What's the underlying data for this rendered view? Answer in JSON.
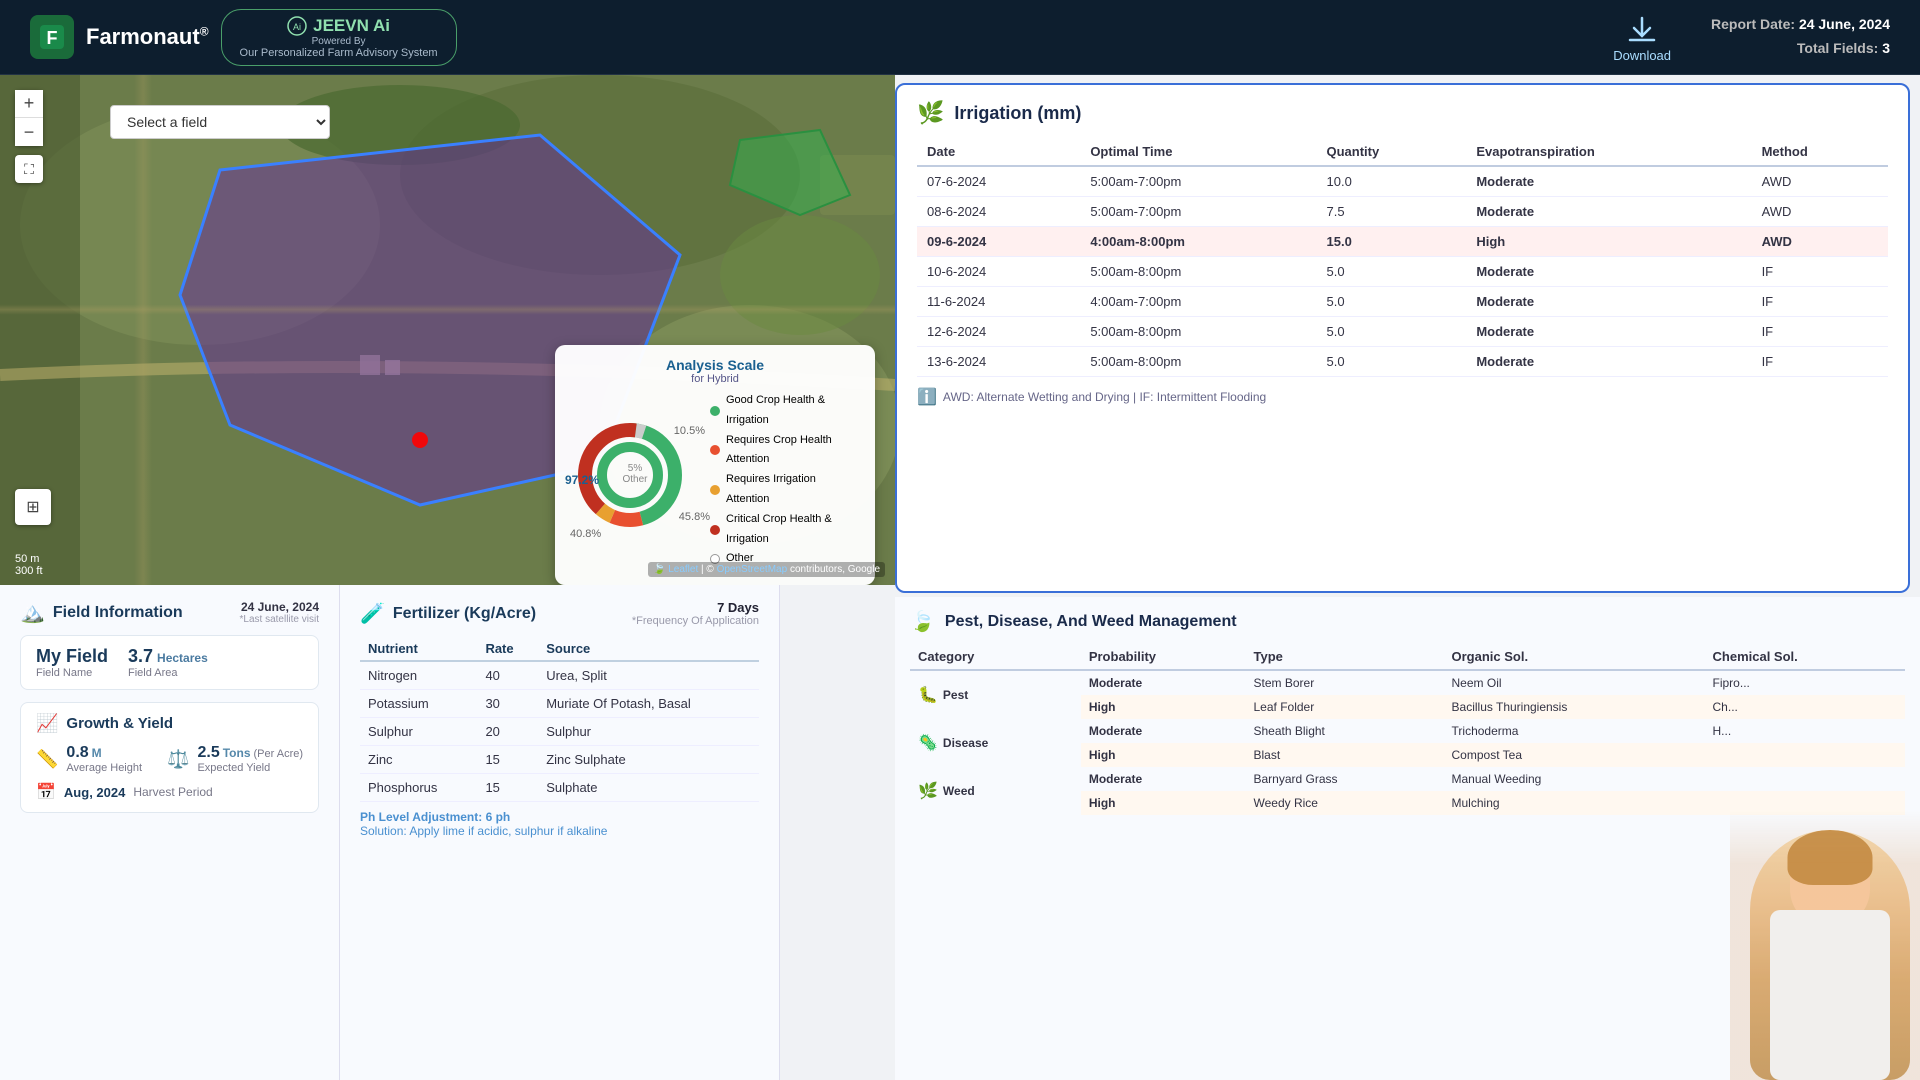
{
  "header": {
    "logo_letter": "F",
    "app_name": "Farmonaut",
    "reg_symbol": "®",
    "jeevn_title": "JEEVN Ai",
    "powered_by": "Powered By",
    "jeevn_sub": "Our Personalized Farm Advisory System",
    "download_label": "Download",
    "report_date_label": "Report Date:",
    "report_date": "24 June, 2024",
    "total_fields_label": "Total Fields:",
    "total_fields": "3"
  },
  "map": {
    "field_select_placeholder": "Select a field",
    "zoom_in": "+",
    "zoom_out": "−",
    "scale_m": "50 m",
    "scale_ft": "300 ft",
    "attribution": "Leaflet | © OpenStreetMap contributors, Google"
  },
  "analysis_scale": {
    "title": "Analysis Scale",
    "subtitle": "for Hybrid",
    "percent_97": "97.2%",
    "percent_105": "10.5%",
    "percent_458": "45.8%",
    "percent_5": "5%",
    "percent_other_label": "Other",
    "percent_408": "40.8%",
    "legend": [
      {
        "color": "#3cb06a",
        "label": "Good Crop Health & Irrigation"
      },
      {
        "color": "#e85030",
        "label": "Requires Crop Health Attention"
      },
      {
        "color": "#e8a030",
        "label": "Requires Irrigation Attention"
      },
      {
        "color": "#c03020",
        "label": "Critical Crop Health & Irrigation"
      },
      {
        "color": "#ffffff",
        "label": "Other",
        "border": "#999"
      }
    ]
  },
  "field_info": {
    "title": "Field Information",
    "date": "24 June, 2024",
    "last_sat": "*Last satellite visit",
    "field_name": "My Field",
    "field_name_label": "Field Name",
    "area_value": "3.7",
    "area_unit": "Hectares",
    "area_label": "Field Area",
    "growth_title": "Growth & Yield",
    "height_value": "0.8",
    "height_unit": "M",
    "height_label": "Average Height",
    "yield_value": "2.5",
    "yield_unit": "Tons",
    "yield_per": "(Per Acre)",
    "yield_label": "Expected Yield",
    "harvest_month": "Aug, 2024",
    "harvest_label": "Harvest Period"
  },
  "fertilizer": {
    "title": "Fertilizer (Kg/Acre)",
    "days": "7 Days",
    "freq": "*Frequency Of Application",
    "columns": [
      "Nutrient",
      "Rate",
      "Source"
    ],
    "rows": [
      {
        "nutrient": "Nitrogen",
        "rate": "40",
        "source": "Urea, Split"
      },
      {
        "nutrient": "Potassium",
        "rate": "30",
        "source": "Muriate Of Potash, Basal"
      },
      {
        "nutrient": "Sulphur",
        "rate": "20",
        "source": "Sulphur"
      },
      {
        "nutrient": "Zinc",
        "rate": "15",
        "source": "Zinc Sulphate"
      },
      {
        "nutrient": "Phosphorus",
        "rate": "15",
        "source": "Sulphate"
      }
    ],
    "ph_label": "Ph Level Adjustment:",
    "ph_value": "6 ph",
    "solution_label": "Solution:",
    "solution_text": "Apply lime if acidic, sulphur if alkaline"
  },
  "irrigation": {
    "title": "Irrigation (mm)",
    "columns": [
      "Date",
      "Optimal Time",
      "Quantity",
      "Evapotranspiration",
      "Method"
    ],
    "rows": [
      {
        "date": "07-6-2024",
        "time": "5:00am-7:00pm",
        "qty": "10.0",
        "evap": "Moderate",
        "evap_level": "moderate",
        "method": "AWD",
        "highlight": false
      },
      {
        "date": "08-6-2024",
        "time": "5:00am-7:00pm",
        "qty": "7.5",
        "evap": "Moderate",
        "evap_level": "moderate",
        "method": "AWD",
        "highlight": false
      },
      {
        "date": "09-6-2024",
        "time": "4:00am-8:00pm",
        "qty": "15.0",
        "evap": "High",
        "evap_level": "high",
        "method": "AWD",
        "highlight": true
      },
      {
        "date": "10-6-2024",
        "time": "5:00am-8:00pm",
        "qty": "5.0",
        "evap": "Moderate",
        "evap_level": "moderate",
        "method": "IF",
        "highlight": false
      },
      {
        "date": "11-6-2024",
        "time": "4:00am-7:00pm",
        "qty": "5.0",
        "evap": "Moderate",
        "evap_level": "moderate",
        "method": "IF",
        "highlight": false
      },
      {
        "date": "12-6-2024",
        "time": "5:00am-8:00pm",
        "qty": "5.0",
        "evap": "Moderate",
        "evap_level": "moderate",
        "method": "IF",
        "highlight": false
      },
      {
        "date": "13-6-2024",
        "time": "5:00am-8:00pm",
        "qty": "5.0",
        "evap": "Moderate",
        "evap_level": "moderate",
        "method": "IF",
        "highlight": false
      }
    ],
    "footer": "AWD: Alternate Wetting and Drying | IF: Intermittent Flooding"
  },
  "pest": {
    "title": "Pest, Disease, And Weed Management",
    "columns": [
      "Category",
      "Probability",
      "Type",
      "Organic Sol.",
      "Chemical Sol."
    ],
    "categories": [
      {
        "name": "Pest",
        "icon": "🐛",
        "rows": [
          {
            "prob": "Moderate",
            "prob_level": "moderate",
            "type": "Stem Borer",
            "organic": "Neem Oil",
            "chemical": "Fipro..."
          },
          {
            "prob": "High",
            "prob_level": "high",
            "type": "Leaf Folder",
            "organic": "Bacillus Thuringiensis",
            "chemical": "Ch..."
          }
        ]
      },
      {
        "name": "Disease",
        "icon": "🦠",
        "rows": [
          {
            "prob": "Moderate",
            "prob_level": "moderate",
            "type": "Sheath Blight",
            "organic": "Trichoderma",
            "chemical": "H..."
          },
          {
            "prob": "High",
            "prob_level": "high",
            "type": "Blast",
            "organic": "Compost Tea",
            "chemical": ""
          }
        ]
      },
      {
        "name": "Weed",
        "icon": "🌿",
        "rows": [
          {
            "prob": "Moderate",
            "prob_level": "moderate",
            "type": "Barnyard Grass",
            "organic": "Manual Weeding",
            "chemical": ""
          },
          {
            "prob": "High",
            "prob_level": "high",
            "type": "Weedy Rice",
            "organic": "Mulching",
            "chemical": ""
          }
        ]
      }
    ]
  }
}
